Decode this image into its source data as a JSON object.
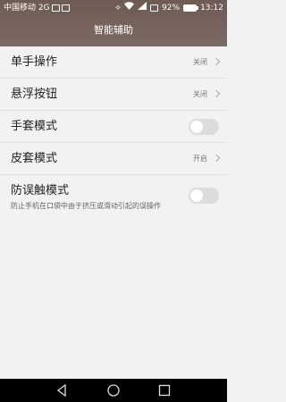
{
  "status_bar": {
    "carrier": "中国移动 2G",
    "battery": "92%",
    "time": "13:12"
  },
  "header": {
    "title": "智能辅助"
  },
  "settings": [
    {
      "title": "单手操作",
      "value": "关闭",
      "control": "chevron"
    },
    {
      "title": "悬浮按钮",
      "value": "关闭",
      "control": "chevron"
    },
    {
      "title": "手套模式",
      "control": "toggle",
      "enabled": false
    },
    {
      "title": "皮套模式",
      "value": "开启",
      "control": "chevron"
    },
    {
      "title": "防误触模式",
      "subtitle": "防止手机在口袋中由于挤压或滑动引起的误操作",
      "control": "toggle",
      "enabled": false
    }
  ],
  "colors": {
    "header_bg": "#735f57",
    "page_bg": "#f2f2f2",
    "toggle_off": "#dcdcdc"
  }
}
